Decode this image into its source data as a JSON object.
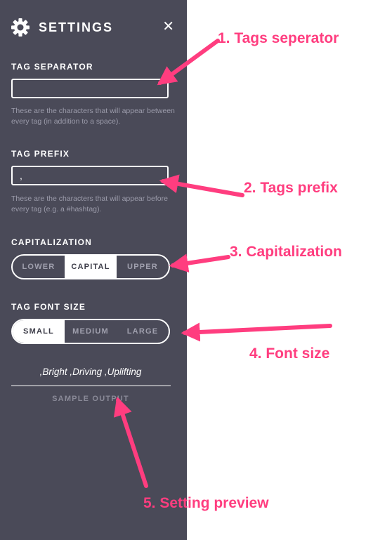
{
  "header": {
    "title": "SETTINGS",
    "close_glyph": "✕",
    "icons": {
      "settings": "gear-icon",
      "close": "close-icon"
    }
  },
  "tag_separator": {
    "label": "TAG SEPARATOR",
    "value": "",
    "help": "These are the characters that will appear between every tag (in addition to a space)."
  },
  "tag_prefix": {
    "label": "TAG PREFIX",
    "value": ",",
    "help": "These are the characters that will appear before every tag (e.g. a #hashtag)."
  },
  "capitalization": {
    "label": "CAPITALIZATION",
    "options": [
      "LOWER",
      "CAPITAL",
      "UPPER"
    ],
    "selected": "CAPITAL"
  },
  "font_size": {
    "label": "TAG FONT SIZE",
    "options": [
      "SMALL",
      "MEDIUM",
      "LARGE"
    ],
    "selected": "SMALL"
  },
  "sample": {
    "output": ",Bright ,Driving ,Uplifting",
    "label": "SAMPLE OUTPUT"
  },
  "annotations": [
    "1. Tags seperator",
    "2. Tags prefix",
    "3. Capitalization",
    "4. Font size",
    "5. Setting preview"
  ],
  "colors": {
    "panel_bg": "#4a4a58",
    "annotation": "#ff3d7f",
    "muted_text": "#9b9baa"
  }
}
